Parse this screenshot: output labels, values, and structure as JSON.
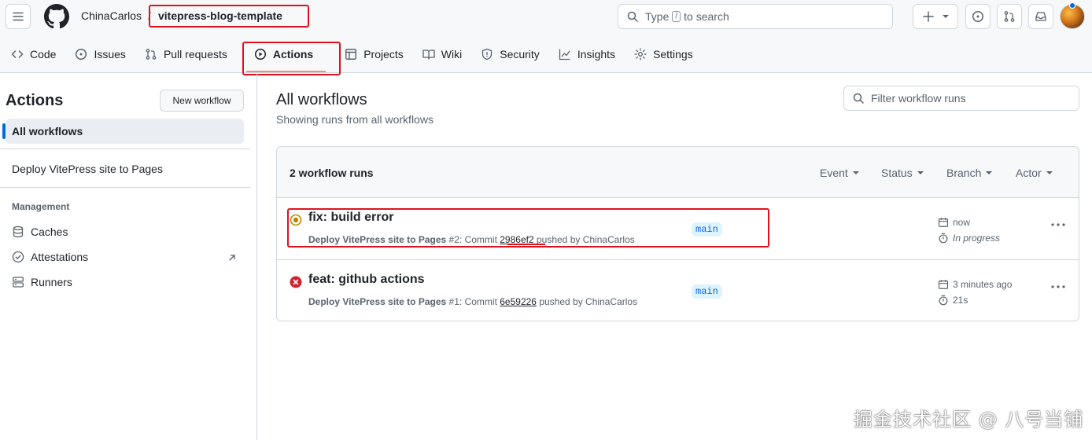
{
  "header": {
    "owner": "ChinaCarlos",
    "separator": "/",
    "repo": "vitepress-blog-template",
    "search_prefix": "Type",
    "search_key": "/",
    "search_suffix": "to search"
  },
  "nav_tabs": [
    {
      "label": "Code",
      "icon": "code-icon"
    },
    {
      "label": "Issues",
      "icon": "issue-opened-icon"
    },
    {
      "label": "Pull requests",
      "icon": "git-pull-request-icon"
    },
    {
      "label": "Actions",
      "icon": "play-icon",
      "active": true
    },
    {
      "label": "Projects",
      "icon": "table-icon"
    },
    {
      "label": "Wiki",
      "icon": "book-icon"
    },
    {
      "label": "Security",
      "icon": "shield-icon"
    },
    {
      "label": "Insights",
      "icon": "graph-icon"
    },
    {
      "label": "Settings",
      "icon": "gear-icon"
    }
  ],
  "sidebar": {
    "title": "Actions",
    "new_workflow": "New workflow",
    "all_workflows": "All workflows",
    "workflow": "Deploy VitePress site to Pages",
    "management_heading": "Management",
    "management_items": [
      {
        "label": "Caches",
        "icon": "database-icon"
      },
      {
        "label": "Attestations",
        "icon": "verified-icon"
      },
      {
        "label": "Runners",
        "icon": "server-icon"
      }
    ]
  },
  "main": {
    "title": "All workflows",
    "subtitle": "Showing runs from all workflows",
    "filter_placeholder": "Filter workflow runs",
    "runs_count": "2 workflow runs",
    "filters": [
      "Event",
      "Status",
      "Branch",
      "Actor"
    ],
    "runs": [
      {
        "title": "fix: build error",
        "workflow": "Deploy VitePress site to Pages",
        "run_number": "#2",
        "commit_label": ": Commit",
        "sha": "2986ef2",
        "pushed_by": "pushed by",
        "actor": "ChinaCarlos",
        "branch": "main",
        "when": "now",
        "duration": "In progress",
        "status": "in_progress"
      },
      {
        "title": "feat: github actions",
        "workflow": "Deploy VitePress site to Pages",
        "run_number": "#1",
        "commit_label": ": Commit",
        "sha": "6e59226",
        "pushed_by": "pushed by",
        "actor": "ChinaCarlos",
        "branch": "main",
        "when": "3 minutes ago",
        "duration": "21s",
        "status": "failure"
      }
    ]
  },
  "watermark": "掘金技术社区 @ 八号当铺",
  "colors": {
    "accent": "#0969da",
    "tab_underline": "#fd8c73",
    "in_progress": "#bf8700",
    "failure": "#cf222e",
    "annotation": "#e0101b"
  }
}
